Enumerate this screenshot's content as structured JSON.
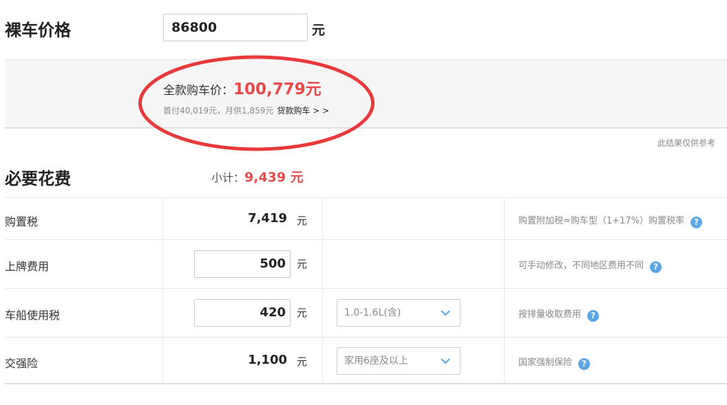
{
  "bare_price": {
    "title": "裸车价格",
    "value": "86800",
    "unit": "元"
  },
  "total": {
    "label": "全款购车价：",
    "value": "100,779元",
    "sub": "首付40,019元，月供1,859元",
    "loan_link": "贷款购车 > >",
    "highlight_color": "#e83a3a"
  },
  "note": "此结果仅供参考",
  "required": {
    "title": "必要花费",
    "subtotal_label": "小计：",
    "subtotal_value": "9,439 元",
    "rows": [
      {
        "name": "购置税",
        "value": "7,419",
        "unit": "元",
        "hint": "购置附加税=购车型（1+17%）购置税率",
        "editable": false
      },
      {
        "name": "上牌费用",
        "value": "500",
        "unit": "元",
        "hint": "可手动修改，不同地区费用不同",
        "editable": true
      },
      {
        "name": "车船使用税",
        "value": "420",
        "unit": "元",
        "select": "1.0-1.6L(含)",
        "hint": "按排量收取费用",
        "editable": true
      },
      {
        "name": "交强险",
        "value": "1,100",
        "unit": "元",
        "select": "家用6座及以上",
        "hint": "国家强制保险",
        "editable": false
      }
    ]
  },
  "icons": {
    "help": "question-circle-icon",
    "dropdown": "chevron-down-icon"
  },
  "colors": {
    "accent_red": "#e84a4a",
    "help_blue": "#5aa6e6"
  }
}
